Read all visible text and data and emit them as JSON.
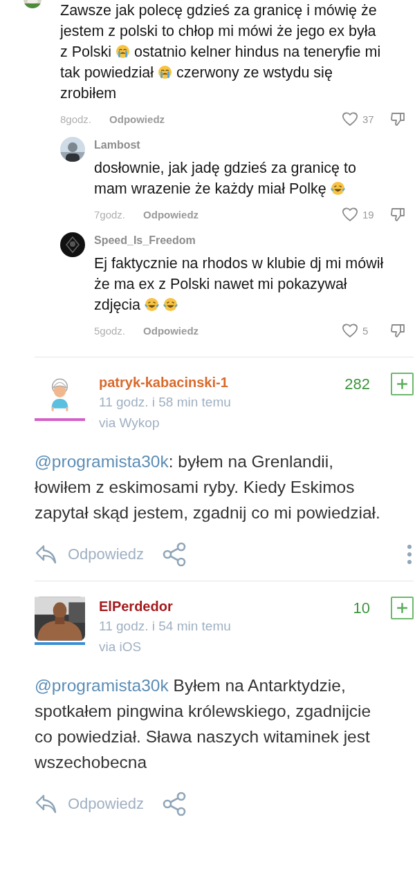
{
  "top_comments": [
    {
      "avatar": {
        "kind": "picture"
      },
      "body": [
        {
          "kind": "text",
          "text": "Zawsze jak polecę gdzieś za granicę i mówię że jestem z polski to chłop mi mówi że jego ex była z Polski"
        },
        {
          "kind": "crying"
        },
        {
          "kind": "text",
          "text": "ostatnio kelner hindus na teneryfie mi tak powiedział"
        },
        {
          "kind": "crying"
        },
        {
          "kind": "text",
          "text": "czerwony ze wstydu się zrobiłem"
        }
      ],
      "time": "8godz.",
      "reply": "Odpowiedz",
      "likes": "37",
      "replies": [
        {
          "author": "Lambost",
          "avatar": {
            "kind": "picture"
          },
          "body": [
            {
              "kind": "text",
              "text": "dosłownie, jak jadę gdzieś za granicę to mam wrazenie że każdy miał Polkę"
            },
            {
              "kind": "laughing"
            }
          ],
          "time": "7godz.",
          "reply": "Odpowiedz",
          "likes": "19"
        },
        {
          "author": "Speed_Is_Freedom",
          "avatar": {
            "kind": "dark"
          },
          "body": [
            {
              "kind": "text",
              "text": "Ej faktycznie na rhodos w klubie dj mi mówił że ma ex z Polski nawet mi pokazywał zdjęcia"
            },
            {
              "kind": "laughing"
            },
            {
              "kind": "laughing"
            }
          ],
          "time": "5godz.",
          "reply": "Odpowiedz",
          "likes": "5"
        }
      ]
    }
  ],
  "posts": [
    {
      "author": {
        "name": "patryk-kabacinski-1",
        "color": "#d9692b"
      },
      "avatar": {
        "kind": "default",
        "color": "#d45fc8"
      },
      "time": "11 godz. i 58 min temu",
      "via": "via Wykop",
      "score": "282",
      "body": [
        {
          "kind": "mention",
          "text": "@programista30k"
        },
        {
          "kind": "text",
          "text": ": byłem na Grenlandii, łowiłem z eskimosami ryby. Kiedy Eskimos zapytał skąd jestem, zgadnij co mi powiedział."
        }
      ],
      "reply": "Odpowiedz",
      "more": true
    },
    {
      "author": {
        "name": "ElPerdedor",
        "color": "#a3191c"
      },
      "avatar": {
        "kind": "picture",
        "color": "#3a8fd6"
      },
      "time": "11 godz. i 54 min temu",
      "via": "via iOS",
      "score": "10",
      "body": [
        {
          "kind": "mention",
          "text": "@programista30k"
        },
        {
          "kind": "text",
          "text": " Byłem na Antarktydzie, spotkałem pingwina królewskiego, zgadnijcie co powiedział. Sława naszych witaminek jest wszechobecna"
        }
      ],
      "reply": "Odpowiedz",
      "more": false
    }
  ]
}
